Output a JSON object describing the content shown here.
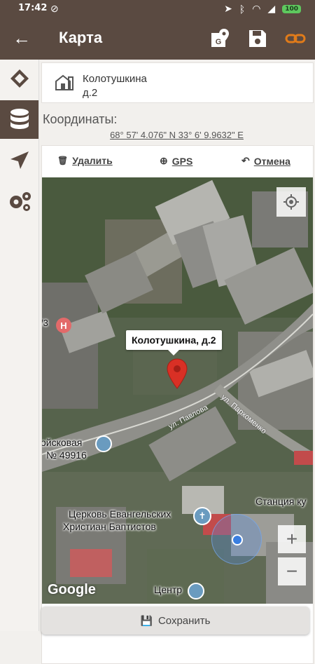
{
  "status": {
    "time": "17:42",
    "battery": "100"
  },
  "appbar": {
    "title": "Карта"
  },
  "address": {
    "street": "Колотушкина",
    "number": "д.2"
  },
  "coordinates": {
    "label": "Координаты:",
    "value": "68° 57' 4.076\" N 33° 6' 9.9632\" E"
  },
  "tools": {
    "delete": "Удалить",
    "gps": "GPS",
    "cancel": "Отмена"
  },
  "map": {
    "marker_title": "Колотушкина, д.2",
    "road1": "ул. Павлова",
    "road2": "ул. Пархоменко",
    "poi_left_top": "ойсковая",
    "poi_left_bottom": "№ 49916",
    "poi_station": "Станция ку",
    "poi_church_1": "Церковь Евангельских",
    "poi_church_2": "Христиан Баптистов",
    "poi_center_1": "Центр",
    "poi_center_2": "...",
    "poi_hospital": "Н",
    "poi_edge": "/3",
    "zoom_in": "+",
    "zoom_out": "−",
    "attribution": "Google"
  },
  "save": {
    "label": "Сохранить"
  },
  "colors": {
    "brand": "#5a4a41",
    "accent": "#e07b1a",
    "marker": "#d93025"
  }
}
